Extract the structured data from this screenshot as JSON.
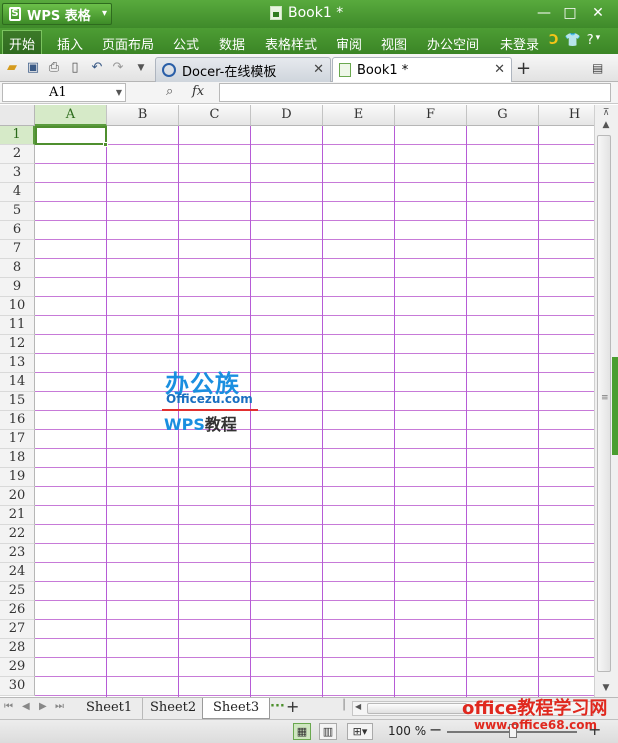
{
  "app": {
    "name": "WPS 表格",
    "logo_letter": "S"
  },
  "document": {
    "title": "Book1 *"
  },
  "window_controls": {
    "minimize": "—",
    "restore": "□",
    "close": "✕"
  },
  "ribbon": {
    "tabs": [
      "开始",
      "插入",
      "页面布局",
      "公式",
      "数据",
      "表格样式",
      "审阅",
      "视图",
      "办公空间"
    ],
    "active_tab": "开始",
    "login": "未登录",
    "help": "?",
    "icons": [
      "wps-moon-icon",
      "shirt-skin-icon",
      "help-icon"
    ]
  },
  "quick_access": {
    "icons": [
      "open-folder-icon",
      "save-icon",
      "print-icon",
      "print-preview-icon",
      "undo-icon",
      "redo-icon",
      "customize-dropdown-icon"
    ]
  },
  "doc_tabs": [
    {
      "label": "Docer-在线模板",
      "close": "✕"
    },
    {
      "label": "Book1 *",
      "close": "✕"
    }
  ],
  "doc_tab_add": "+",
  "formula_bar": {
    "name_box": "A1",
    "fx_label": "fx",
    "formula": ""
  },
  "columns": [
    "A",
    "B",
    "C",
    "D",
    "E",
    "F",
    "G",
    "H"
  ],
  "rows": [
    "1",
    "2",
    "3",
    "4",
    "5",
    "6",
    "7",
    "8",
    "9",
    "10",
    "11",
    "12",
    "13",
    "14",
    "15",
    "16",
    "17",
    "18",
    "19",
    "20",
    "21",
    "22",
    "23",
    "24",
    "25",
    "26",
    "27",
    "28",
    "29",
    "30"
  ],
  "selection": {
    "cell": "A1",
    "column": "A",
    "row": "1"
  },
  "watermark": {
    "line1": "办公族",
    "line2": "Officezu.com",
    "line3_left": "WPS",
    "line3_right": "教程"
  },
  "sheets": {
    "tabs": [
      "Sheet1",
      "Sheet2",
      "Sheet3"
    ],
    "active": "Sheet3",
    "more": "···",
    "add": "+"
  },
  "statusbar": {
    "zoom": "100 %",
    "zoom_minus": "−",
    "zoom_plus": "+"
  },
  "site_watermark": {
    "line1": "office教程学习网",
    "line2": "www.office68.com"
  },
  "colors": {
    "title_green": "#4d9d34",
    "grid_line": "#b65bd6",
    "selection_green": "#4f8f2f",
    "watermark_red": "#e0281e"
  }
}
